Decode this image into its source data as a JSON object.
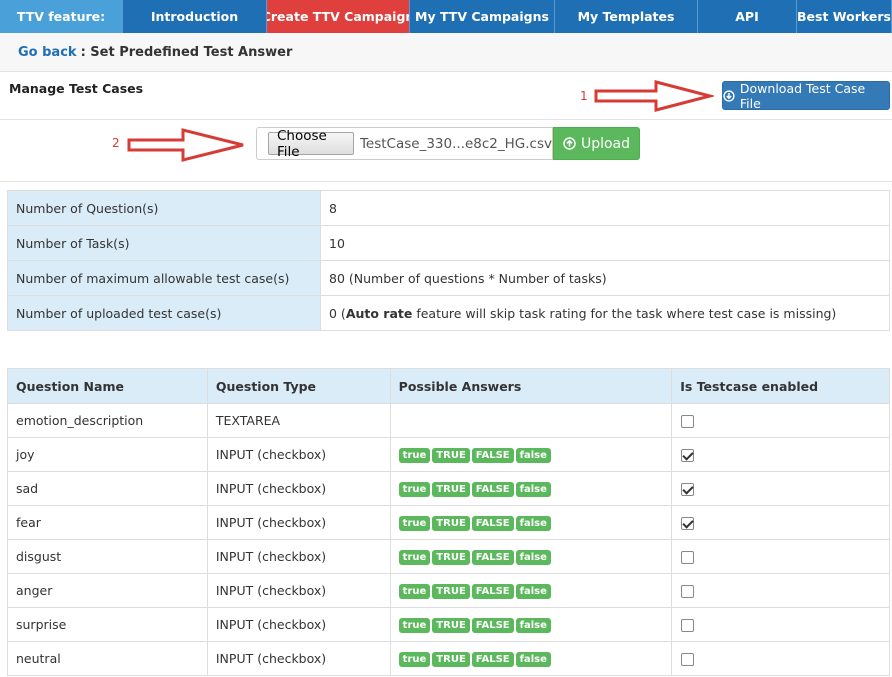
{
  "nav": {
    "feature": "TTV feature:",
    "items": [
      "Introduction",
      "Create TTV Campaign",
      "My TTV Campaigns",
      "My Templates",
      "API",
      "Best Workers"
    ]
  },
  "breadcrumb": {
    "back": "Go back",
    "text": ": Set Predefined Test Answer"
  },
  "manage": {
    "title": "Manage Test Cases",
    "download_label": "Download Test Case File",
    "annotation1": "1",
    "annotation2": "2"
  },
  "upload": {
    "choose_label": "Choose File",
    "filename": "TestCase_330...e8c2_HG.csv",
    "upload_label": "Upload"
  },
  "stats": [
    {
      "label": "Number of Question(s)",
      "value": "8"
    },
    {
      "label": "Number of Task(s)",
      "value": "10"
    },
    {
      "label": "Number of maximum allowable test case(s)",
      "value": "80 (Number of questions * Number of tasks)"
    },
    {
      "label": "Number of uploaded test case(s)",
      "value_prefix": "0 (",
      "value_bold": "Auto rate",
      "value_suffix": " feature will skip task rating for the task where test case is missing)"
    }
  ],
  "table": {
    "headers": [
      "Question Name",
      "Question Type",
      "Possible Answers",
      "Is Testcase enabled"
    ],
    "answers": [
      "true",
      "TRUE",
      "FALSE",
      "false"
    ],
    "rows": [
      {
        "name": "emotion_description",
        "type": "TEXTAREA",
        "has_answers": false,
        "enabled": false
      },
      {
        "name": "joy",
        "type": "INPUT (checkbox)",
        "has_answers": true,
        "enabled": true
      },
      {
        "name": "sad",
        "type": "INPUT (checkbox)",
        "has_answers": true,
        "enabled": true
      },
      {
        "name": "fear",
        "type": "INPUT (checkbox)",
        "has_answers": true,
        "enabled": true
      },
      {
        "name": "disgust",
        "type": "INPUT (checkbox)",
        "has_answers": true,
        "enabled": false
      },
      {
        "name": "anger",
        "type": "INPUT (checkbox)",
        "has_answers": true,
        "enabled": false
      },
      {
        "name": "surprise",
        "type": "INPUT (checkbox)",
        "has_answers": true,
        "enabled": false
      },
      {
        "name": "neutral",
        "type": "INPUT (checkbox)",
        "has_answers": true,
        "enabled": false
      }
    ]
  },
  "colors": {
    "nav": "#1f6fb4",
    "nav_active": "#e0403d",
    "header_bg": "#d9ecf7",
    "badge": "#5cb85c",
    "annotation": "#d63b36"
  }
}
